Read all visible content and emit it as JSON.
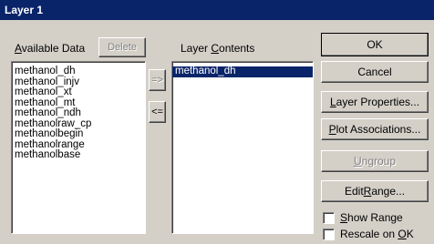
{
  "window": {
    "title": "Layer 1"
  },
  "available": {
    "label_pre": "",
    "label_key": "A",
    "label_post": "vailable Data",
    "delete_label": "Delete",
    "items": [
      "methanol_dh",
      "methanol_injv",
      "methanol_xt",
      "methanol_mt",
      "methanol_ndh",
      "methanolraw_cp",
      "methanolbegin",
      "methanolrange",
      "methanolbase"
    ]
  },
  "transfer": {
    "add_label": "=>",
    "remove_label": "<="
  },
  "layer": {
    "label_pre": "Layer ",
    "label_key": "C",
    "label_post": "ontents",
    "items": [
      "methanol_dh"
    ]
  },
  "buttons": {
    "ok": "OK",
    "cancel": "Cancel",
    "layer_properties": {
      "pre": "",
      "key": "L",
      "post": "ayer Properties..."
    },
    "plot_associations": {
      "pre": "",
      "key": "P",
      "post": "lot Associations..."
    },
    "ungroup": {
      "pre": "",
      "key": "U",
      "post": "ngroup"
    },
    "edit_range": {
      "pre": "Edit ",
      "key": "R",
      "post": "ange..."
    }
  },
  "checks": {
    "show_range": {
      "pre": "",
      "key": "S",
      "post": "how Range",
      "checked": false
    },
    "rescale_on_ok": {
      "pre": "Rescale on ",
      "key": "O",
      "post": "K",
      "checked": false
    }
  }
}
